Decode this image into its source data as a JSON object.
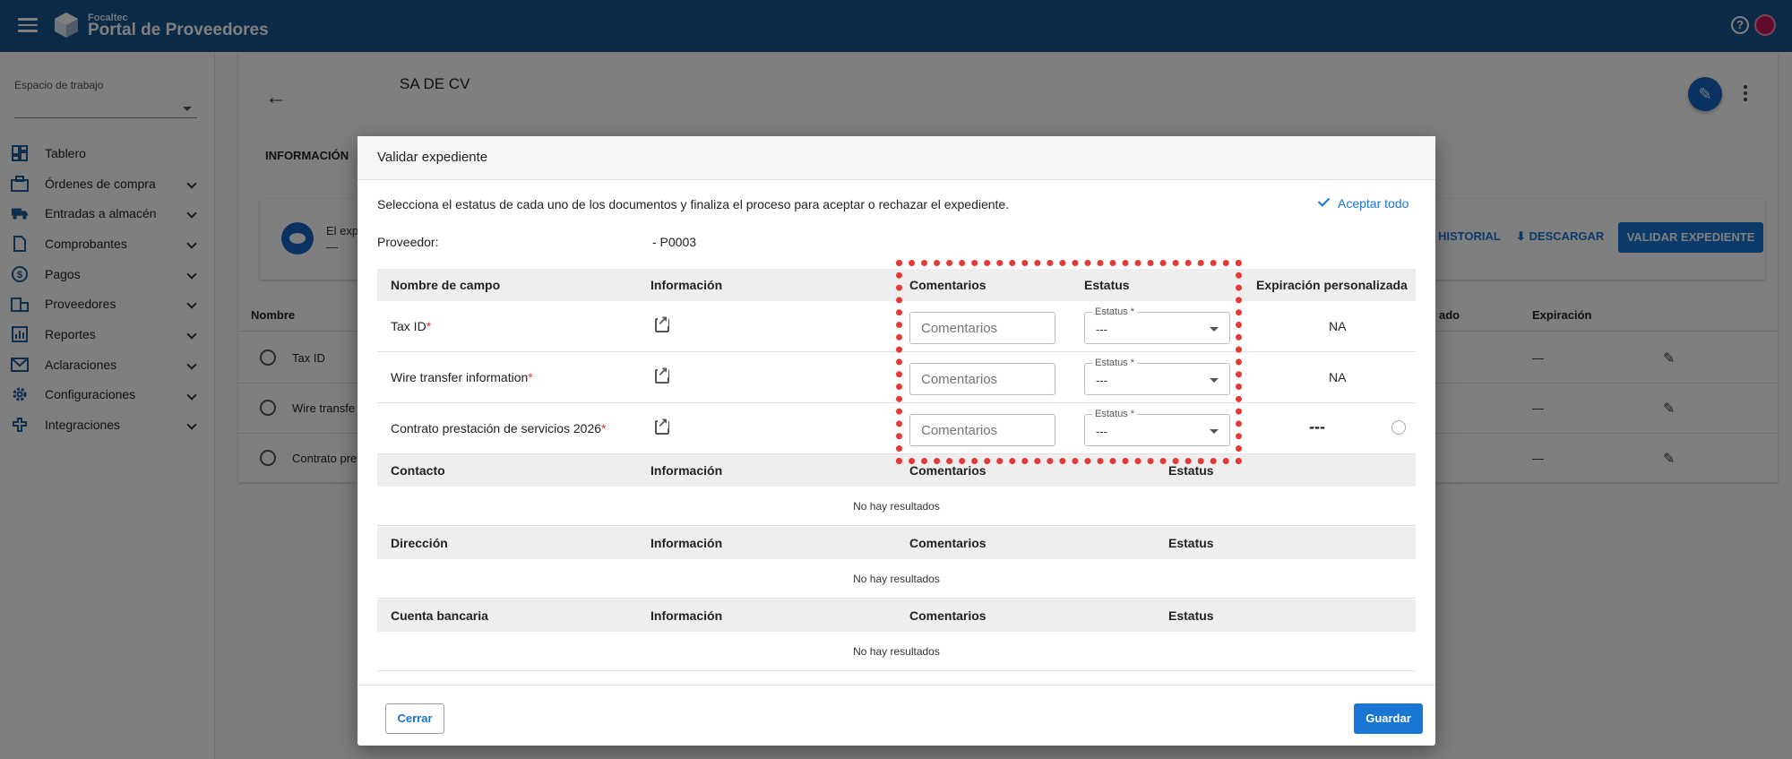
{
  "topbar": {
    "brand_small": "Focaltec",
    "brand_big": "Portal de Proveedores",
    "help": "?"
  },
  "sidebar": {
    "workspace_label": "Espacio de trabajo",
    "items": [
      {
        "label": "Tablero",
        "icon": "dashboard-icon",
        "expandable": false
      },
      {
        "label": "Órdenes de compra",
        "icon": "purchase-orders-icon",
        "expandable": true
      },
      {
        "label": "Entradas a almacén",
        "icon": "truck-icon",
        "expandable": true
      },
      {
        "label": "Comprobantes",
        "icon": "document-icon",
        "expandable": true
      },
      {
        "label": "Pagos",
        "icon": "dollar-icon",
        "expandable": true
      },
      {
        "label": "Proveedores",
        "icon": "building-icon",
        "expandable": true
      },
      {
        "label": "Reportes",
        "icon": "chart-icon",
        "expandable": true
      },
      {
        "label": "Aclaraciones",
        "icon": "mail-icon",
        "expandable": true
      },
      {
        "label": "Configuraciones",
        "icon": "gear-icon",
        "expandable": true
      },
      {
        "label": "Integraciones",
        "icon": "integration-icon",
        "expandable": true
      }
    ]
  },
  "main": {
    "title": "SA DE CV",
    "tab": "INFORMACIÓN",
    "info_text": "El exp",
    "info_sub": "—",
    "historial": "HISTORIAL",
    "descargar": "DESCARGAR",
    "validar": "VALIDAR EXPEDIENTE",
    "headers": {
      "nombre": "Nombre",
      "estado": "ado",
      "expiracion": "Expiración"
    },
    "rows": [
      {
        "name": "Tax ID",
        "exp": "—"
      },
      {
        "name": "Wire transfe",
        "exp": "—"
      },
      {
        "name": "Contrato pre",
        "exp": "—"
      }
    ]
  },
  "dialog": {
    "title": "Validar expediente",
    "instructions": "Selecciona el estatus de cada uno de los documentos y finaliza el proceso para aceptar o rechazar el expediente.",
    "accept_all": "Aceptar todo",
    "provider_label": "Proveedor:",
    "provider_value": "- P0003",
    "fields_table": {
      "headers": {
        "name": "Nombre de campo",
        "info": "Información",
        "comments": "Comentarios",
        "status": "Estatus",
        "expiration": "Expiración personalizada"
      },
      "rows": [
        {
          "name": "Tax ID",
          "required": "*",
          "comment_placeholder": "Comentarios",
          "status_label": "Estatus *",
          "status_value": "---",
          "expiration": "NA"
        },
        {
          "name": "Wire transfer information",
          "required": "*",
          "comment_placeholder": "Comentarios",
          "status_label": "Estatus *",
          "status_value": "---",
          "expiration": "NA"
        },
        {
          "name": "Contrato prestación de servicios 2026",
          "required": "*",
          "comment_placeholder": "Comentarios",
          "status_label": "Estatus *",
          "status_value": "---",
          "expiration": "---"
        }
      ]
    },
    "sections": [
      {
        "name": "Contacto",
        "info": "Información",
        "comments": "Comentarios",
        "status": "Estatus",
        "empty": "No hay resultados"
      },
      {
        "name": "Dirección",
        "info": "Información",
        "comments": "Comentarios",
        "status": "Estatus",
        "empty": "No hay resultados"
      },
      {
        "name": "Cuenta bancaria",
        "info": "Información",
        "comments": "Comentarios",
        "status": "Estatus",
        "empty": "No hay resultados"
      }
    ],
    "close_label": "Cerrar",
    "save_label": "Guardar"
  },
  "colors": {
    "topbar": "#16548f",
    "primary": "#1976d2",
    "required": "#e53935",
    "highlight": "#e53935"
  }
}
